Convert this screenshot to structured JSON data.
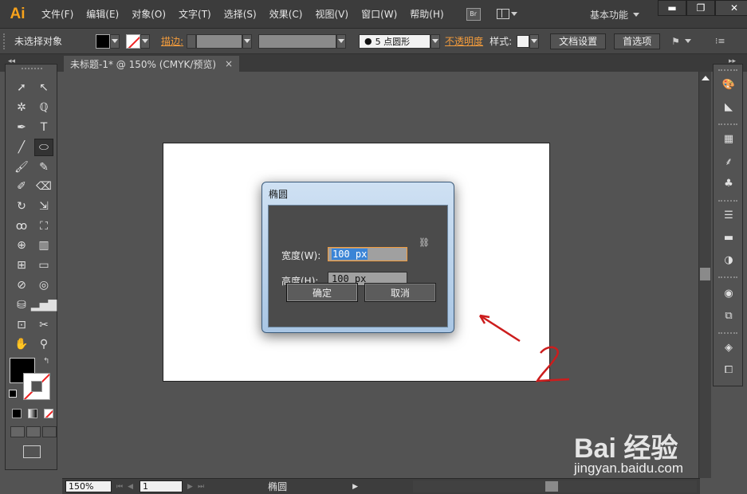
{
  "app": {
    "logo": "Ai"
  },
  "menu": [
    "文件(F)",
    "编辑(E)",
    "对象(O)",
    "文字(T)",
    "选择(S)",
    "效果(C)",
    "视图(V)",
    "窗口(W)",
    "帮助(H)"
  ],
  "bridge_icon_label": "Br",
  "workspace_label": "基本功能",
  "window_buttons": {
    "minimize": "▬",
    "maximize": "❐",
    "close": "✕"
  },
  "control_bar": {
    "selection_status": "未选择对象",
    "stroke_label": "描边:",
    "brush_label": "5 点圆形",
    "opacity_label": "不透明度",
    "style_label": "样式:",
    "doc_setup": "文档设置",
    "preferences": "首选项"
  },
  "document_tab": {
    "title": "未标题-1* @ 150% (CMYK/预览)",
    "close": "×"
  },
  "dialog": {
    "title": "椭圆",
    "width_label": "宽度(W):",
    "width_value": "100 px",
    "height_label": "高度(H):",
    "height_value": "100 px",
    "ok": "确定",
    "cancel": "取消"
  },
  "annotation": {
    "number": "2",
    "color": "#cc1d1d"
  },
  "statusbar": {
    "zoom": "150%",
    "page": "1",
    "tool_name": "椭圆"
  },
  "watermark": {
    "brand": "Bai 经验",
    "url": "jingyan.baidu.com"
  },
  "colors": {
    "accent_orange": "#f7a21b",
    "ui_bg": "#535353",
    "dialog_frame": "#a9c6e4",
    "focus_orange": "#f39c3c"
  }
}
